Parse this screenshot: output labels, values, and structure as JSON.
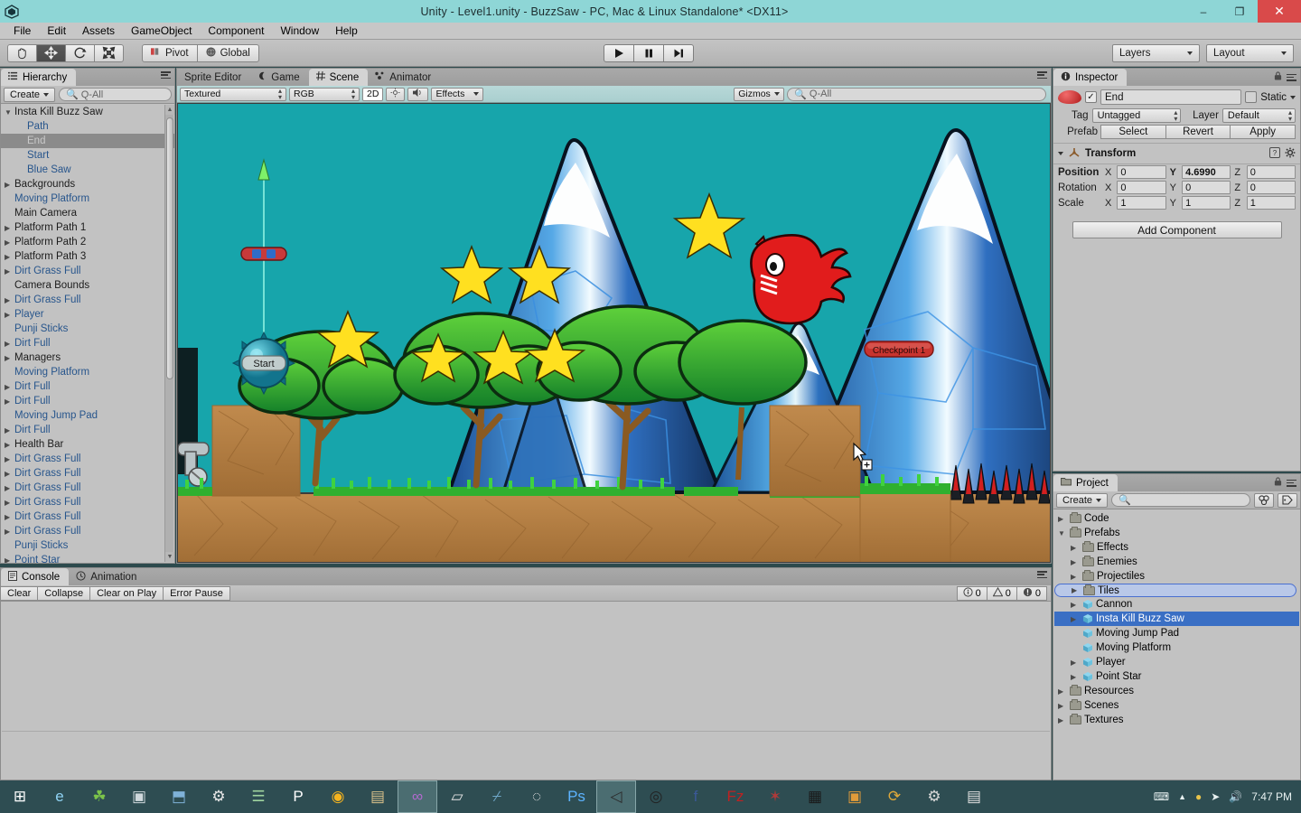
{
  "window": {
    "title": "Unity - Level1.unity - BuzzSaw - PC, Mac & Linux Standalone* <DX11>",
    "minimize": "–",
    "maximize": "❐",
    "close": "✕"
  },
  "menubar": {
    "items": [
      "File",
      "Edit",
      "Assets",
      "GameObject",
      "Component",
      "Window",
      "Help"
    ]
  },
  "toolbar": {
    "tools": [
      {
        "name": "hand-tool",
        "glyph": "✋"
      },
      {
        "name": "move-tool",
        "glyph": "✥"
      },
      {
        "name": "rotate-tool",
        "glyph": "⟳"
      },
      {
        "name": "scale-tool",
        "glyph": "⤢"
      }
    ],
    "pivot_label": "Pivot",
    "global_label": "Global",
    "play_label": "▶",
    "pause_label": "▐▐",
    "step_label": "▶|",
    "layers_label": "Layers",
    "layout_label": "Layout"
  },
  "hierarchy": {
    "tab": "Hierarchy",
    "create_label": "Create",
    "search_placeholder": "Q-All",
    "items": [
      {
        "label": "Insta Kill Buzz Saw",
        "indent": 0,
        "arrow": "▼",
        "prefab": false,
        "selected": false
      },
      {
        "label": "Path",
        "indent": 1,
        "arrow": "",
        "prefab": true,
        "selected": false
      },
      {
        "label": "End",
        "indent": 1,
        "arrow": "",
        "prefab": true,
        "selected": true
      },
      {
        "label": "Start",
        "indent": 1,
        "arrow": "",
        "prefab": true,
        "selected": false
      },
      {
        "label": "Blue Saw",
        "indent": 1,
        "arrow": "",
        "prefab": true,
        "selected": false
      },
      {
        "label": "Backgrounds",
        "indent": 0,
        "arrow": "▶",
        "prefab": false,
        "selected": false
      },
      {
        "label": "Moving Platform",
        "indent": 0,
        "arrow": "",
        "prefab": true,
        "selected": false
      },
      {
        "label": "Main Camera",
        "indent": 0,
        "arrow": "",
        "prefab": false,
        "selected": false
      },
      {
        "label": "Platform Path 1",
        "indent": 0,
        "arrow": "▶",
        "prefab": false,
        "selected": false
      },
      {
        "label": "Platform Path 2",
        "indent": 0,
        "arrow": "▶",
        "prefab": false,
        "selected": false
      },
      {
        "label": "Platform Path 3",
        "indent": 0,
        "arrow": "▶",
        "prefab": false,
        "selected": false
      },
      {
        "label": "Dirt Grass Full",
        "indent": 0,
        "arrow": "▶",
        "prefab": true,
        "selected": false
      },
      {
        "label": "Camera Bounds",
        "indent": 0,
        "arrow": "",
        "prefab": false,
        "selected": false
      },
      {
        "label": "Dirt Grass Full",
        "indent": 0,
        "arrow": "▶",
        "prefab": true,
        "selected": false
      },
      {
        "label": "Player",
        "indent": 0,
        "arrow": "▶",
        "prefab": true,
        "selected": false
      },
      {
        "label": "Punji Sticks",
        "indent": 0,
        "arrow": "",
        "prefab": true,
        "selected": false
      },
      {
        "label": "Dirt Full",
        "indent": 0,
        "arrow": "▶",
        "prefab": true,
        "selected": false
      },
      {
        "label": "Managers",
        "indent": 0,
        "arrow": "▶",
        "prefab": false,
        "selected": false
      },
      {
        "label": "Moving Platform",
        "indent": 0,
        "arrow": "",
        "prefab": true,
        "selected": false
      },
      {
        "label": "Dirt Full",
        "indent": 0,
        "arrow": "▶",
        "prefab": true,
        "selected": false
      },
      {
        "label": "Dirt Full",
        "indent": 0,
        "arrow": "▶",
        "prefab": true,
        "selected": false
      },
      {
        "label": "Moving Jump Pad",
        "indent": 0,
        "arrow": "",
        "prefab": true,
        "selected": false
      },
      {
        "label": "Dirt Full",
        "indent": 0,
        "arrow": "▶",
        "prefab": true,
        "selected": false
      },
      {
        "label": "Health Bar",
        "indent": 0,
        "arrow": "▶",
        "prefab": false,
        "selected": false
      },
      {
        "label": "Dirt Grass Full",
        "indent": 0,
        "arrow": "▶",
        "prefab": true,
        "selected": false
      },
      {
        "label": "Dirt Grass Full",
        "indent": 0,
        "arrow": "▶",
        "prefab": true,
        "selected": false
      },
      {
        "label": "Dirt Grass Full",
        "indent": 0,
        "arrow": "▶",
        "prefab": true,
        "selected": false
      },
      {
        "label": "Dirt Grass Full",
        "indent": 0,
        "arrow": "▶",
        "prefab": true,
        "selected": false
      },
      {
        "label": "Dirt Grass Full",
        "indent": 0,
        "arrow": "▶",
        "prefab": true,
        "selected": false
      },
      {
        "label": "Dirt Grass Full",
        "indent": 0,
        "arrow": "▶",
        "prefab": true,
        "selected": false
      },
      {
        "label": "Punji Sticks",
        "indent": 0,
        "arrow": "",
        "prefab": true,
        "selected": false
      },
      {
        "label": "Point Star",
        "indent": 0,
        "arrow": "▶",
        "prefab": true,
        "selected": false
      }
    ]
  },
  "scene": {
    "tabs": [
      {
        "label": "Sprite Editor",
        "active": false
      },
      {
        "label": "Game",
        "active": false
      },
      {
        "label": "Scene",
        "active": true
      },
      {
        "label": "Animator",
        "active": false
      }
    ],
    "draw_mode": "Textured",
    "color_mode": "RGB",
    "mode_2d": "2D",
    "lighting_icon": "☼",
    "audio_icon": "◂))",
    "effects_label": "Effects",
    "gizmos_label": "Gizmos",
    "gizmo_search_placeholder": "Q-All",
    "labels": {
      "start_handle": "Start",
      "checkpoint": "Checkpoint 1"
    }
  },
  "inspector": {
    "tab": "Inspector",
    "object_name": "End",
    "static_label": "Static",
    "tag_label": "Tag",
    "tag_value": "Untagged",
    "layer_label": "Layer",
    "layer_value": "Default",
    "prefab_label": "Prefab",
    "prefab_buttons": [
      "Select",
      "Revert",
      "Apply"
    ],
    "component": {
      "title": "Transform",
      "rows": [
        {
          "label": "Position",
          "bold": true,
          "x": "0",
          "y": "4.6990",
          "z": "0",
          "y_bold": true
        },
        {
          "label": "Rotation",
          "bold": false,
          "x": "0",
          "y": "0",
          "z": "0",
          "y_bold": false
        },
        {
          "label": "Scale",
          "bold": false,
          "x": "1",
          "y": "1",
          "z": "1",
          "y_bold": false
        }
      ],
      "axis_labels": [
        "X",
        "Y",
        "Z"
      ]
    },
    "add_component_label": "Add Component"
  },
  "project": {
    "tab": "Project",
    "create_label": "Create",
    "search_placeholder": "",
    "items": [
      {
        "label": "Code",
        "indent": 0,
        "arrow": "▶",
        "icon": "folder",
        "state": ""
      },
      {
        "label": "Prefabs",
        "indent": 0,
        "arrow": "▼",
        "icon": "folder",
        "state": ""
      },
      {
        "label": "Effects",
        "indent": 1,
        "arrow": "▶",
        "icon": "folder",
        "state": ""
      },
      {
        "label": "Enemies",
        "indent": 1,
        "arrow": "▶",
        "icon": "folder",
        "state": ""
      },
      {
        "label": "Projectiles",
        "indent": 1,
        "arrow": "▶",
        "icon": "folder",
        "state": ""
      },
      {
        "label": "Tiles",
        "indent": 1,
        "arrow": "▶",
        "icon": "folder",
        "state": "outline"
      },
      {
        "label": "Cannon",
        "indent": 1,
        "arrow": "▶",
        "icon": "prefab",
        "state": ""
      },
      {
        "label": "Insta Kill Buzz Saw",
        "indent": 1,
        "arrow": "▶",
        "icon": "prefab",
        "state": "selected"
      },
      {
        "label": "Moving Jump Pad",
        "indent": 1,
        "arrow": "",
        "icon": "prefab",
        "state": ""
      },
      {
        "label": "Moving Platform",
        "indent": 1,
        "arrow": "",
        "icon": "prefab",
        "state": ""
      },
      {
        "label": "Player",
        "indent": 1,
        "arrow": "▶",
        "icon": "prefab",
        "state": ""
      },
      {
        "label": "Point Star",
        "indent": 1,
        "arrow": "▶",
        "icon": "prefab",
        "state": ""
      },
      {
        "label": "Resources",
        "indent": 0,
        "arrow": "▶",
        "icon": "folder",
        "state": ""
      },
      {
        "label": "Scenes",
        "indent": 0,
        "arrow": "▶",
        "icon": "folder",
        "state": ""
      },
      {
        "label": "Textures",
        "indent": 0,
        "arrow": "▶",
        "icon": "folder",
        "state": ""
      }
    ]
  },
  "console": {
    "tabs": [
      {
        "label": "Console",
        "active": true
      },
      {
        "label": "Animation",
        "active": false
      }
    ],
    "buttons": [
      "Clear",
      "Collapse",
      "Clear on Play",
      "Error Pause"
    ],
    "counts": {
      "info": "0",
      "warning": "0",
      "error": "0"
    }
  },
  "taskbar": {
    "time": "7:47 PM",
    "items": [
      {
        "name": "start-button",
        "glyph": "⊞",
        "color": "#ffffff",
        "active": false
      },
      {
        "name": "internet-explorer-icon",
        "glyph": "e",
        "color": "#8fd3f4",
        "active": false
      },
      {
        "name": "clover-icon",
        "glyph": "☘",
        "color": "#7cc44a",
        "active": false
      },
      {
        "name": "dotnet-tool-icon",
        "glyph": "▣",
        "color": "#cfd8dc",
        "active": false
      },
      {
        "name": "zbrush-icon",
        "glyph": "⬒",
        "color": "#7fb2d8",
        "active": false
      },
      {
        "name": "steam-icon",
        "glyph": "⚙",
        "color": "#e8e8e8",
        "active": false
      },
      {
        "name": "text-editor-icon",
        "glyph": "☰",
        "color": "#9fd49f",
        "active": false
      },
      {
        "name": "paint-icon",
        "glyph": "P",
        "color": "#ffffff",
        "active": false
      },
      {
        "name": "chrome-icon",
        "glyph": "◉",
        "color": "#f5b41f",
        "active": false
      },
      {
        "name": "screenshot-icon",
        "glyph": "▤",
        "color": "#d8c08a",
        "active": false
      },
      {
        "name": "visual-studio-icon",
        "glyph": "∞",
        "color": "#b36ad0",
        "active": true
      },
      {
        "name": "explorer-icon",
        "glyph": "▱",
        "color": "#e4e4e4",
        "active": false
      },
      {
        "name": "blender-icon",
        "glyph": "⌿",
        "color": "#6fa8c9",
        "active": false
      },
      {
        "name": "inkscape-icon",
        "glyph": "◌",
        "color": "#e2e2e2",
        "active": false
      },
      {
        "name": "photoshop-icon",
        "glyph": "Ps",
        "color": "#5cb3ff",
        "active": false
      },
      {
        "name": "unity-icon",
        "glyph": "◁",
        "color": "#2b2b2b",
        "active": true
      },
      {
        "name": "audacity-icon",
        "glyph": "◎",
        "color": "#222222",
        "active": false
      },
      {
        "name": "facebook-icon",
        "glyph": "f",
        "color": "#3b5998",
        "active": false
      },
      {
        "name": "filezilla-icon",
        "glyph": "Fz",
        "color": "#bf2121",
        "active": false
      },
      {
        "name": "ruby-icon",
        "glyph": "✶",
        "color": "#b03a3a",
        "active": false
      },
      {
        "name": "qrcode-icon",
        "glyph": "▦",
        "color": "#1a1a1a",
        "active": false
      },
      {
        "name": "media-icon",
        "glyph": "▣",
        "color": "#e09b3a",
        "active": false
      },
      {
        "name": "sync-icon",
        "glyph": "⟳",
        "color": "#e0a93a",
        "active": false
      },
      {
        "name": "android-icon",
        "glyph": "⚙",
        "color": "#d7d7d7",
        "active": false
      },
      {
        "name": "calculator-icon",
        "glyph": "▤",
        "color": "#dedede",
        "active": false
      }
    ],
    "tray": [
      {
        "name": "keyboard-icon",
        "glyph": "⌨"
      },
      {
        "name": "show-hidden-icons-icon",
        "glyph": "▲"
      },
      {
        "name": "shield-icon",
        "glyph": "●"
      },
      {
        "name": "network-icon",
        "glyph": "➤"
      },
      {
        "name": "volume-icon",
        "glyph": "◂))"
      }
    ]
  }
}
